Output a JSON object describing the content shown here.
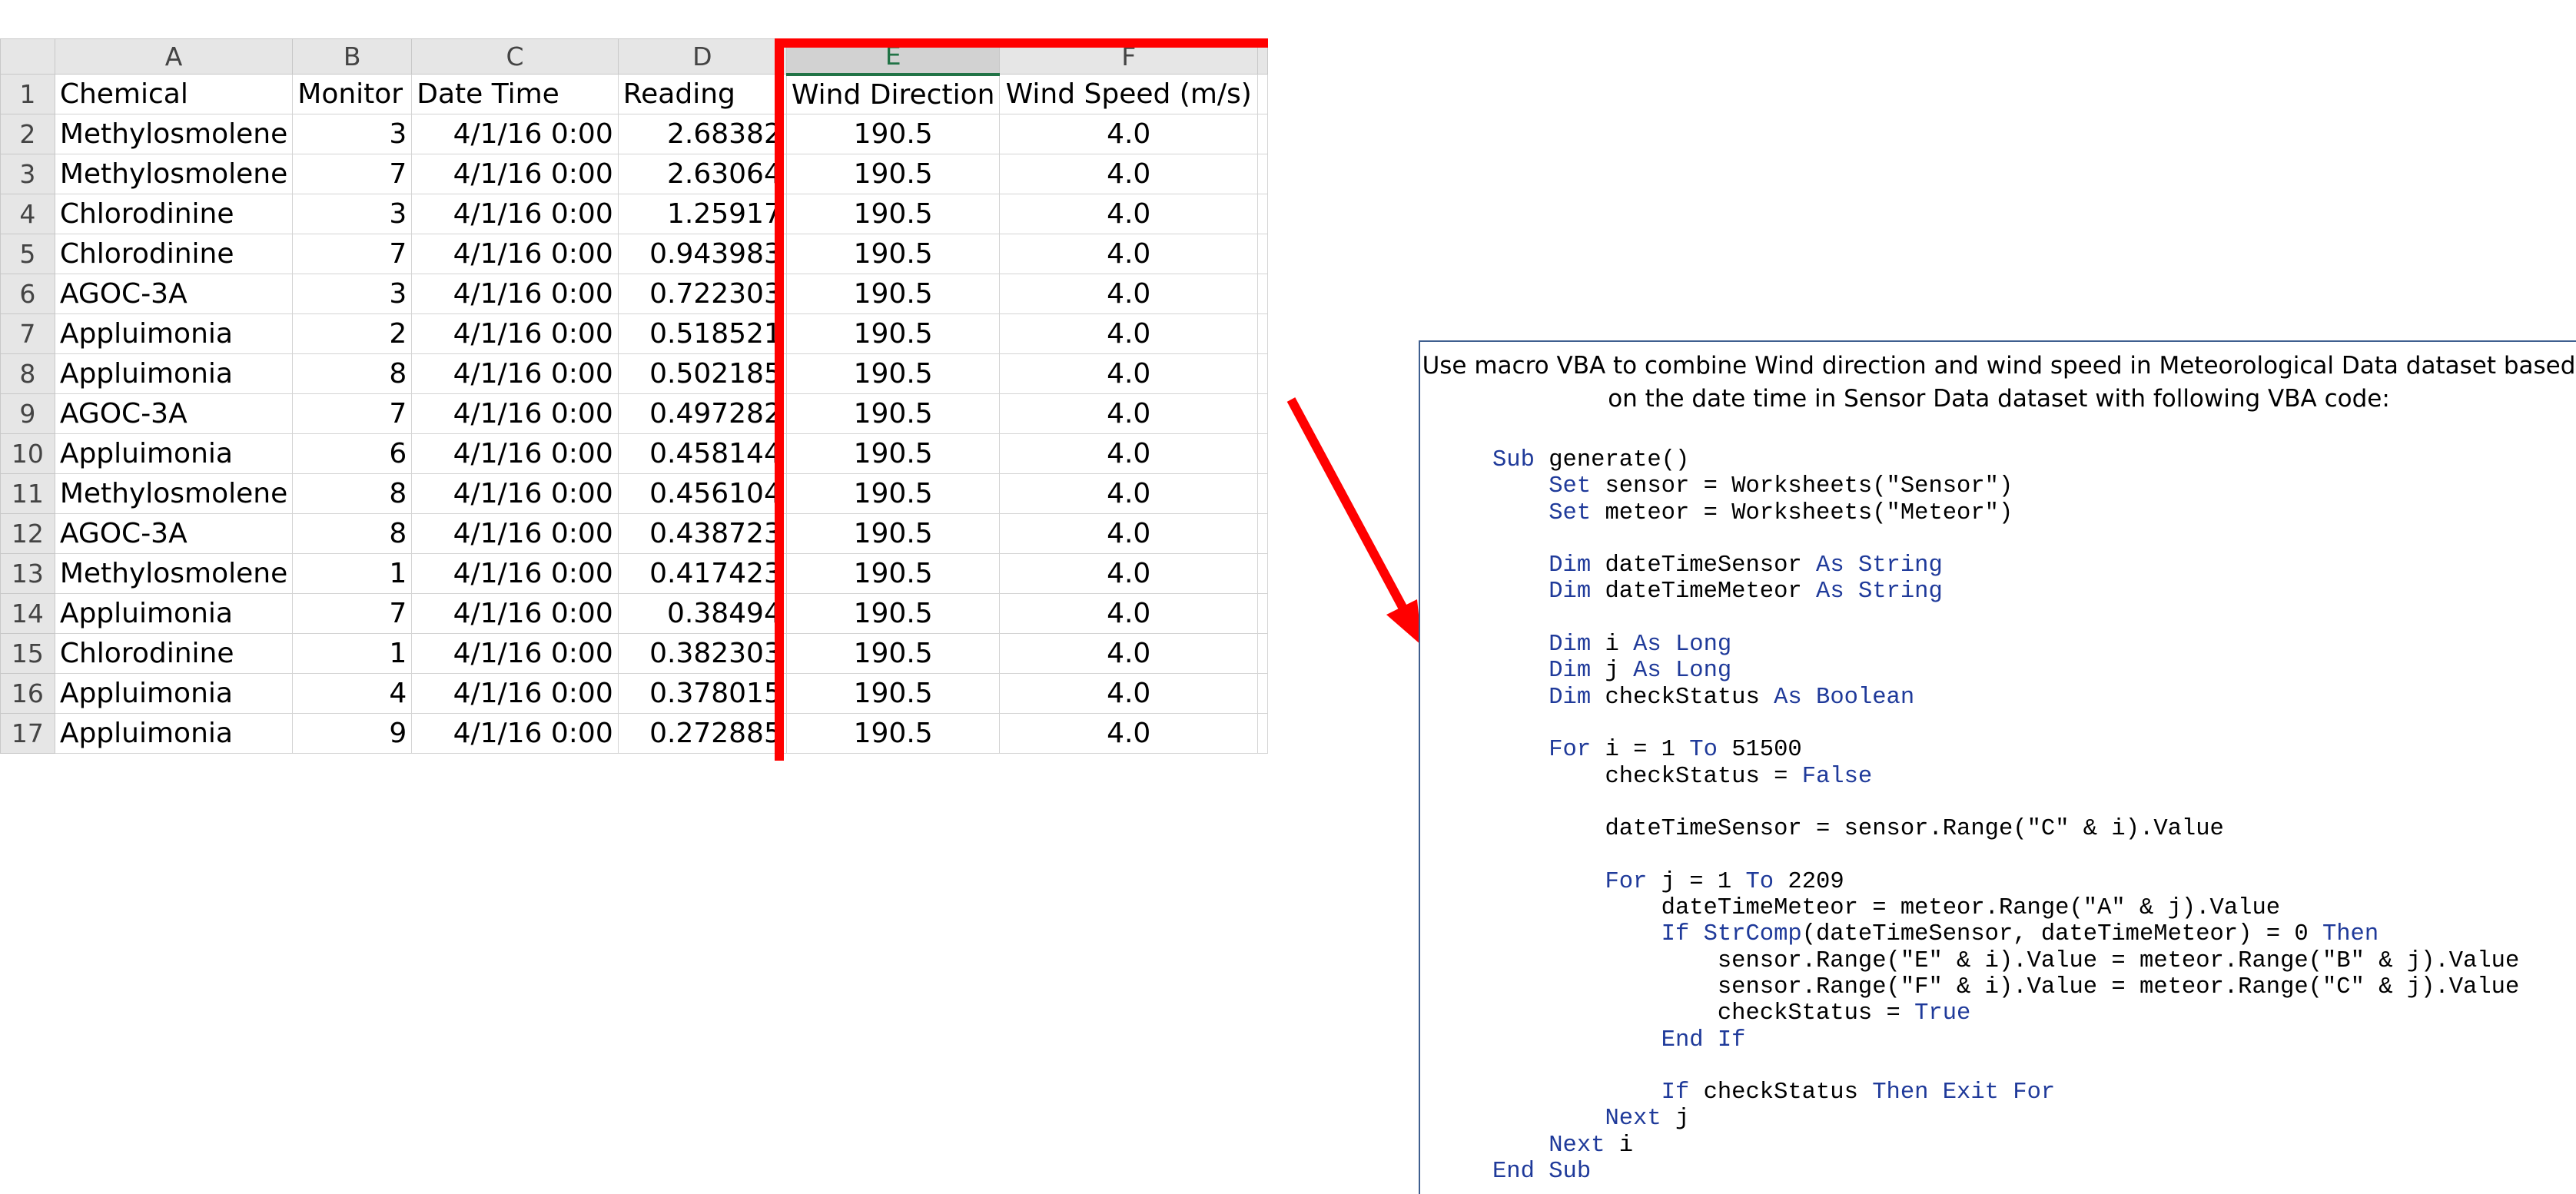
{
  "columns": [
    "A",
    "B",
    "C",
    "D",
    "E",
    "F"
  ],
  "selected_column": "E",
  "header_row": {
    "row": "1",
    "cells": [
      "Chemical",
      "Monitor",
      "Date Time",
      "Reading",
      "Wind Direction",
      "Wind Speed (m/s)"
    ]
  },
  "rows": [
    {
      "row": "2",
      "cells": [
        "Methylosmolene",
        "3",
        "4/1/16 0:00",
        "2.68382",
        "190.5",
        "4.0"
      ]
    },
    {
      "row": "3",
      "cells": [
        "Methylosmolene",
        "7",
        "4/1/16 0:00",
        "2.63064",
        "190.5",
        "4.0"
      ]
    },
    {
      "row": "4",
      "cells": [
        "Chlorodinine",
        "3",
        "4/1/16 0:00",
        "1.25917",
        "190.5",
        "4.0"
      ]
    },
    {
      "row": "5",
      "cells": [
        "Chlorodinine",
        "7",
        "4/1/16 0:00",
        "0.943983",
        "190.5",
        "4.0"
      ]
    },
    {
      "row": "6",
      "cells": [
        "AGOC-3A",
        "3",
        "4/1/16 0:00",
        "0.722303",
        "190.5",
        "4.0"
      ]
    },
    {
      "row": "7",
      "cells": [
        "Appluimonia",
        "2",
        "4/1/16 0:00",
        "0.518521",
        "190.5",
        "4.0"
      ]
    },
    {
      "row": "8",
      "cells": [
        "Appluimonia",
        "8",
        "4/1/16 0:00",
        "0.502185",
        "190.5",
        "4.0"
      ]
    },
    {
      "row": "9",
      "cells": [
        "AGOC-3A",
        "7",
        "4/1/16 0:00",
        "0.497282",
        "190.5",
        "4.0"
      ]
    },
    {
      "row": "10",
      "cells": [
        "Appluimonia",
        "6",
        "4/1/16 0:00",
        "0.458144",
        "190.5",
        "4.0"
      ]
    },
    {
      "row": "11",
      "cells": [
        "Methylosmolene",
        "8",
        "4/1/16 0:00",
        "0.456104",
        "190.5",
        "4.0"
      ]
    },
    {
      "row": "12",
      "cells": [
        "AGOC-3A",
        "8",
        "4/1/16 0:00",
        "0.438723",
        "190.5",
        "4.0"
      ]
    },
    {
      "row": "13",
      "cells": [
        "Methylosmolene",
        "1",
        "4/1/16 0:00",
        "0.417423",
        "190.5",
        "4.0"
      ]
    },
    {
      "row": "14",
      "cells": [
        "Appluimonia",
        "7",
        "4/1/16 0:00",
        "0.38494",
        "190.5",
        "4.0"
      ]
    },
    {
      "row": "15",
      "cells": [
        "Chlorodinine",
        "1",
        "4/1/16 0:00",
        "0.382303",
        "190.5",
        "4.0"
      ]
    },
    {
      "row": "16",
      "cells": [
        "Appluimonia",
        "4",
        "4/1/16 0:00",
        "0.378015",
        "190.5",
        "4.0"
      ]
    },
    {
      "row": "17",
      "cells": [
        "Appluimonia",
        "9",
        "4/1/16 0:00",
        "0.272885",
        "190.5",
        "4.0"
      ]
    }
  ],
  "description": "Use macro VBA to combine Wind direction and wind speed in Meteorological Data dataset based on the date time in Sensor Data dataset with following VBA code:",
  "code_lines": [
    "Sub generate()",
    "    Set sensor = Worksheets(\"Sensor\")",
    "    Set meteor = Worksheets(\"Meteor\")",
    "",
    "    Dim dateTimeSensor As String",
    "    Dim dateTimeMeteor As String",
    "",
    "    Dim i As Long",
    "    Dim j As Long",
    "    Dim checkStatus As Boolean",
    "",
    "    For i = 1 To 51500",
    "        checkStatus = False",
    "",
    "        dateTimeSensor = sensor.Range(\"C\" & i).Value",
    "",
    "        For j = 1 To 2209",
    "            dateTimeMeteor = meteor.Range(\"A\" & j).Value",
    "            If StrComp(dateTimeSensor, dateTimeMeteor) = 0 Then",
    "                sensor.Range(\"E\" & i).Value = meteor.Range(\"B\" & j).Value",
    "                sensor.Range(\"F\" & i).Value = meteor.Range(\"C\" & j).Value",
    "                checkStatus = True",
    "            End If",
    "",
    "            If checkStatus Then Exit For",
    "        Next j",
    "    Next i",
    "End Sub"
  ],
  "colors": {
    "highlight": "#ff0000",
    "keyword": "#1f3a9a",
    "selected_header": "#217346"
  }
}
